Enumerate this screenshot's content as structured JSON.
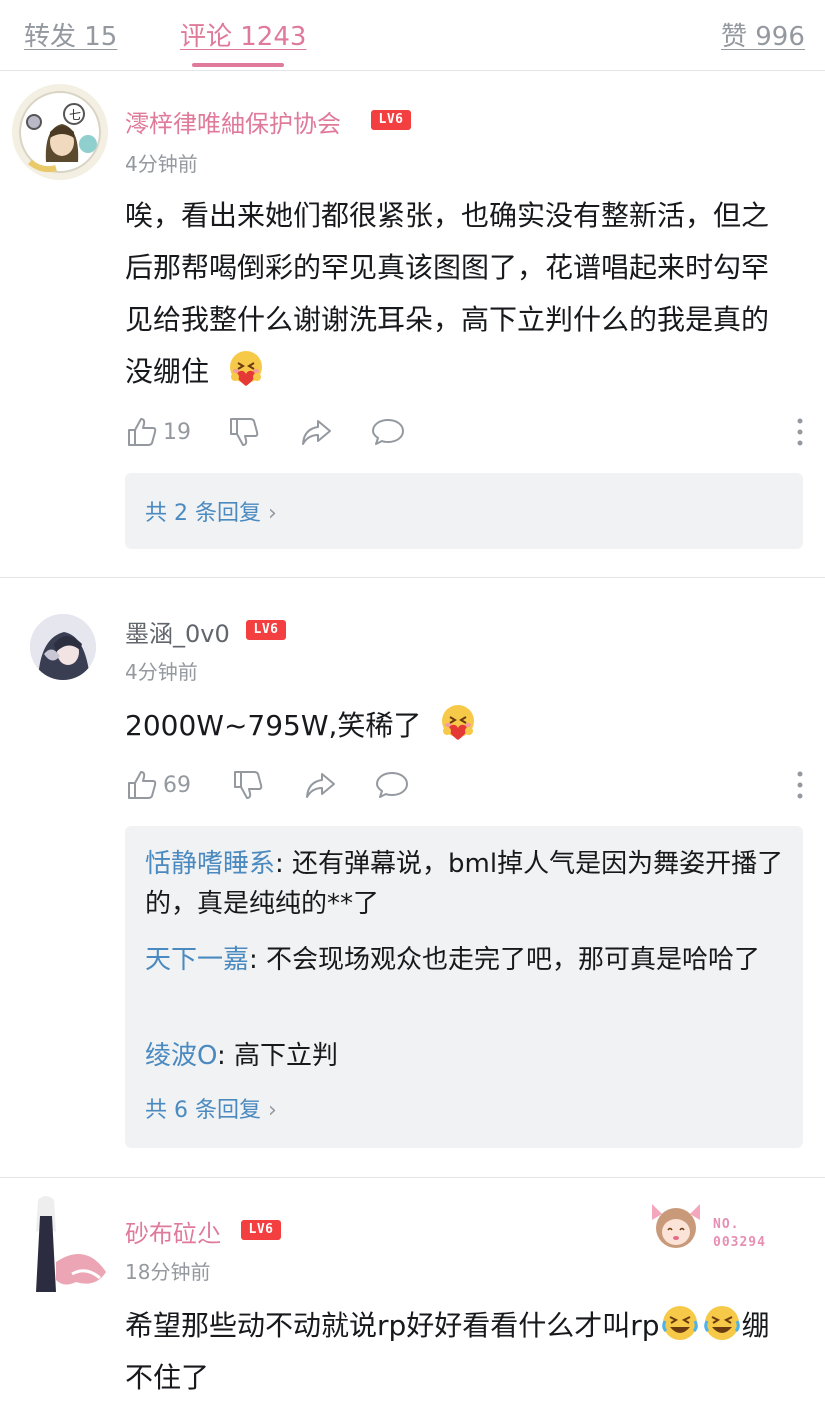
{
  "tabs": {
    "forward_label": "转发 15",
    "comment_label": "评论 1243",
    "like_label": "赞 996"
  },
  "comments": [
    {
      "username": "澪梓律唯紬保护协会",
      "level": "LV6",
      "time": "4分钟前",
      "content": "唉，看出来她们都很紧张，也确实没有整新活，但之后那帮喝倒彩的罕见真该图图了，花谱唱起来时勾罕见给我整什么谢谢洗耳朵，高下立判什么的我是真的没绷住",
      "emoji": "heart-hug-emoji",
      "likes": "19",
      "reply_summary": "共 2 条回复"
    },
    {
      "username": "墨涵_0v0",
      "level": "LV6",
      "time": "4分钟前",
      "content": "2000W~795W,笑稀了",
      "emoji": "heart-hug-emoji",
      "likes": "69",
      "replies": [
        {
          "name": "恬静嗜睡系",
          "text": ": 还有弹幕说，bml掉人气是因为舞姿开播了的，真是纯纯的**了"
        },
        {
          "name": "天下一嘉",
          "text": ": 不会现场观众也走完了吧，那可真是哈哈了"
        },
        {
          "name": "绫波O",
          "text": ": 高下立判"
        }
      ],
      "reply_summary": "共 6 条回复"
    },
    {
      "username": "砂布砬尐",
      "level": "LV6",
      "time": "18分钟前",
      "content": "希望那些动不动就说rp好好看看什么才叫rp",
      "content_tail": "绷不住了",
      "emoji": "rofl-emoji",
      "badge_label": "NO.",
      "badge_number": "003294"
    }
  ],
  "colors": {
    "accent_pink": "#e07a9b",
    "link_blue": "#4a8ac0",
    "level_red": "#f33f3f",
    "muted_gray": "#9499a0"
  }
}
